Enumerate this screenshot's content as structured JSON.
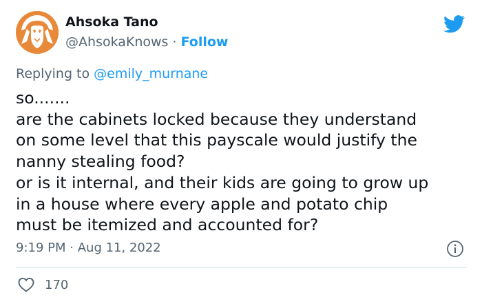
{
  "author": {
    "display_name": "Ahsoka Tano",
    "handle": "@AhsokaKnows",
    "separator": "·",
    "follow_label": "Follow",
    "avatar_icon": "ahsoka-avatar",
    "avatar_color": "#e8893a"
  },
  "brand_icon": "twitter-bird-icon",
  "reply_context": {
    "prefix": "Replying to",
    "mention": "@emily_murnane"
  },
  "tweet": {
    "lines": [
      "so.......",
      "are the cabinets locked because they understand",
      "on some level that this payscale would justify the",
      "nanny stealing food?",
      "or is it internal, and their kids are going to grow up",
      "in a house where every apple and potato chip",
      "must be itemized and accounted for?"
    ]
  },
  "meta": {
    "time": "9:19 PM",
    "separator": "·",
    "date": "Aug 11, 2022",
    "info_icon": "info-icon"
  },
  "engagement": {
    "like_icon": "heart-icon",
    "likes": "170"
  },
  "colors": {
    "accent": "#1d9bf0",
    "secondary_text": "#536471",
    "primary_text": "#0f1419",
    "divider": "#cfd9de"
  }
}
